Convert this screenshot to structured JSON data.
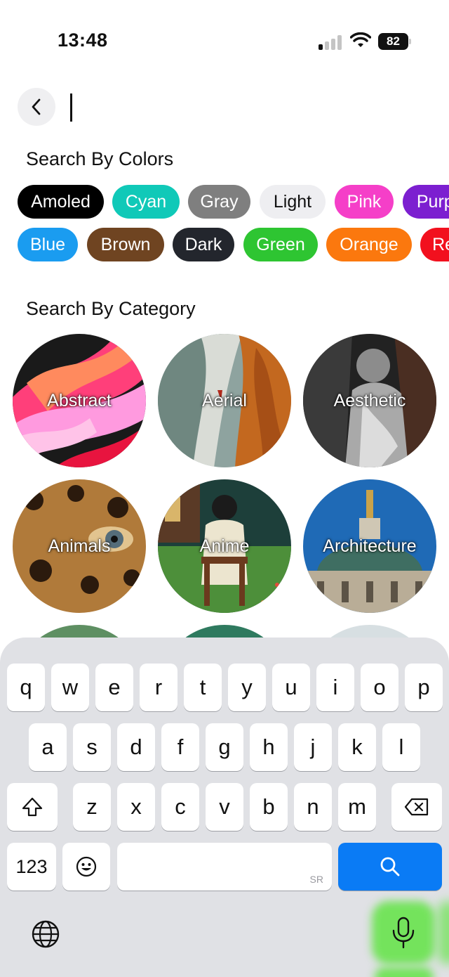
{
  "status_bar": {
    "time": "13:48",
    "battery": "82",
    "signal_bars_active": 1,
    "signal_bars_total": 4
  },
  "search": {
    "value": "",
    "back_icon": "chevron-left-icon"
  },
  "colors_section": {
    "title": "Search By Colors",
    "row1": [
      {
        "label": "Amoled",
        "color": "#000000"
      },
      {
        "label": "Cyan",
        "color": "#10c9b8"
      },
      {
        "label": "Gray",
        "color": "#7f7f7f"
      },
      {
        "label": "Light",
        "color": "#eeeef1",
        "text_color": "#111111"
      },
      {
        "label": "Pink",
        "color": "#f53fc8"
      },
      {
        "label": "Purple",
        "color": "#7c1fd0"
      }
    ],
    "row2": [
      {
        "label": "Blue",
        "color": "#1a9cf0"
      },
      {
        "label": "Brown",
        "color": "#6f4421"
      },
      {
        "label": "Dark",
        "color": "#23262d"
      },
      {
        "label": "Green",
        "color": "#2ec532"
      },
      {
        "label": "Orange",
        "color": "#fb780e"
      },
      {
        "label": "Red",
        "color": "#f2101e"
      }
    ]
  },
  "category_section": {
    "title": "Search By Category",
    "items": [
      {
        "label": "Abstract"
      },
      {
        "label": "Aerial"
      },
      {
        "label": "Aesthetic"
      },
      {
        "label": "Animals"
      },
      {
        "label": "Anime"
      },
      {
        "label": "Architecture"
      }
    ]
  },
  "keyboard": {
    "row1": [
      "q",
      "w",
      "e",
      "r",
      "t",
      "y",
      "u",
      "i",
      "o",
      "p"
    ],
    "row2": [
      "a",
      "s",
      "d",
      "f",
      "g",
      "h",
      "j",
      "k",
      "l"
    ],
    "row3": [
      "z",
      "x",
      "c",
      "v",
      "b",
      "n",
      "m"
    ],
    "numbers_key": "123",
    "space_hint": "SR",
    "shift_icon": "shift-arrow-icon",
    "delete_icon": "backspace-icon",
    "emoji_icon": "emoji-icon",
    "search_icon": "search-icon",
    "globe_icon": "globe-icon",
    "mic_icon": "microphone-icon",
    "accent_color": "#0a7bf5"
  }
}
